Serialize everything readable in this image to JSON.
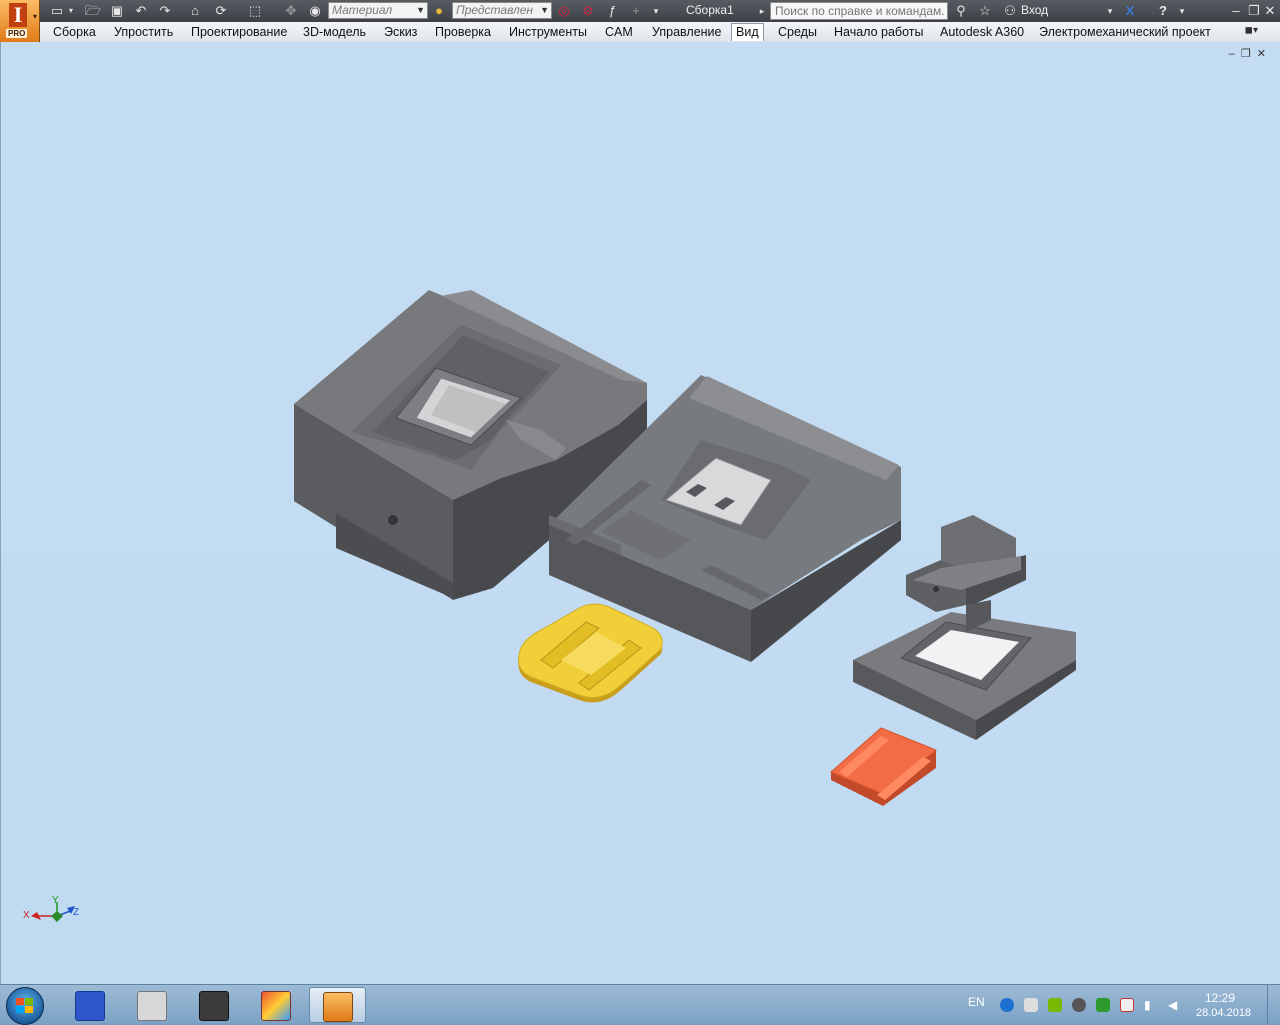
{
  "app": {
    "name": "Autodesk Inventor",
    "edition": "PRO"
  },
  "quick_access": {
    "material_placeholder": "Материал",
    "appearance_placeholder": "Представлен",
    "document_title": "Сборка1",
    "help_search_placeholder": "Поиск по справке и командам...",
    "sign_in": "Вход"
  },
  "ribbon": {
    "tabs": [
      {
        "label": "Сборка"
      },
      {
        "label": "Упростить"
      },
      {
        "label": "Проектирование"
      },
      {
        "label": "3D-модель"
      },
      {
        "label": "Эскиз"
      },
      {
        "label": "Проверка"
      },
      {
        "label": "Инструменты"
      },
      {
        "label": "CAM"
      },
      {
        "label": "Управление"
      },
      {
        "label": "Вид"
      },
      {
        "label": "Среды"
      },
      {
        "label": "Начало работы"
      },
      {
        "label": "Autodesk A360"
      },
      {
        "label": "Электромеханический проект"
      }
    ],
    "active_tab": "Вид"
  },
  "viewport": {
    "axis_labels": {
      "x": "X",
      "y": "Y",
      "z": "Z"
    },
    "parts": [
      {
        "name": "mold-block-left",
        "color": "#5c5e62"
      },
      {
        "name": "mold-block-center",
        "color": "#5c5e62"
      },
      {
        "name": "die-insert-right",
        "color": "#5c5e62"
      },
      {
        "name": "part-yellow",
        "color": "#f2cf3a"
      },
      {
        "name": "part-orange",
        "color": "#f06a42"
      }
    ]
  },
  "taskbar": {
    "language": "EN",
    "time": "12:29",
    "date": "28.04.2018"
  }
}
